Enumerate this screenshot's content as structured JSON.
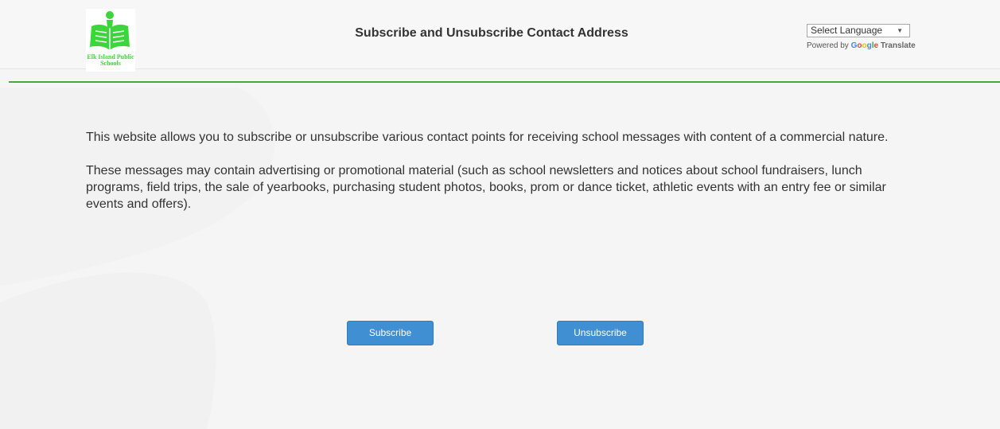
{
  "header": {
    "logo_text": "Elk Island Public Schools",
    "title": "Subscribe and Unsubscribe Contact Address",
    "language_select": {
      "selected": "Select Language",
      "arrow": "▼"
    },
    "powered_by": {
      "prefix": "Powered by",
      "google": [
        "G",
        "o",
        "o",
        "g",
        "l",
        "e"
      ],
      "suffix": "Translate"
    }
  },
  "main": {
    "paragraphs": [
      "This website allows you to subscribe or unsubscribe various contact points for receiving school messages with content of a commercial nature.",
      "These messages may contain advertising or promotional material (such as school newsletters and notices about school fundraisers, lunch programs, field trips, the sale of yearbooks, purchasing student photos, books, prom or dance ticket, athletic events with an entry fee or similar events and offers)."
    ]
  },
  "actions": {
    "subscribe_label": "Subscribe",
    "unsubscribe_label": "Unsubscribe"
  },
  "colors": {
    "accent_green": "#45a83a",
    "logo_green": "#3cd63c",
    "button_blue": "#3f8fd2"
  },
  "icons": {
    "logo": "school-book-person-icon"
  }
}
